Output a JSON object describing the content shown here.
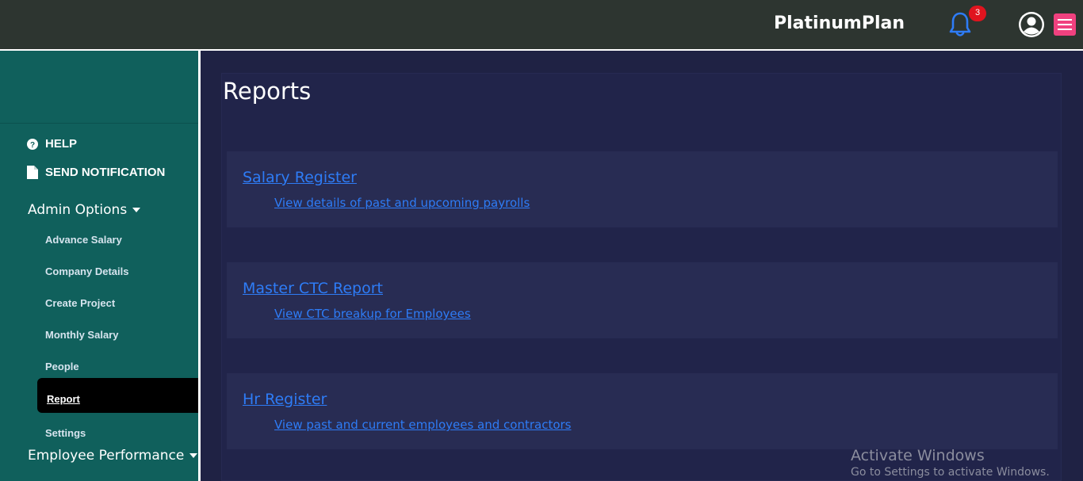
{
  "header": {
    "brand": "PlatinumPlan",
    "notification_count": "3",
    "icons": [
      "bell-icon",
      "user-avatar-icon",
      "hamburger-menu-icon"
    ],
    "colors": {
      "bar": "#2d3530",
      "bell": "#2e7cf6",
      "badge": "#e0141e",
      "menu": "#f0417f"
    }
  },
  "sidebar": {
    "help_label": "HELP",
    "send_notification_label": "SEND NOTIFICATION",
    "admin_options_label": "Admin Options",
    "admin_items": [
      {
        "label": "Advance Salary"
      },
      {
        "label": "Company Details"
      },
      {
        "label": "Create Project"
      },
      {
        "label": "Monthly Salary"
      },
      {
        "label": "People"
      },
      {
        "label": "Report",
        "active": true
      },
      {
        "label": "Settings"
      }
    ],
    "employee_performance_label": "Employee Performance",
    "colors": {
      "background": "#10605c",
      "active": "#000000"
    }
  },
  "main": {
    "title": "Reports",
    "reports": [
      {
        "title": "Salary Register",
        "description": "View details of past and upcoming payrolls"
      },
      {
        "title": "Master CTC Report",
        "description": "View CTC breakup for Employees"
      },
      {
        "title": "Hr Register",
        "description": "View past and current employees and contractors"
      }
    ],
    "colors": {
      "background": "#1f2244",
      "card": "#282c53",
      "link": "#2e7cf6"
    }
  },
  "watermark": {
    "title": "Activate Windows",
    "subtitle": "Go to Settings to activate Windows."
  }
}
